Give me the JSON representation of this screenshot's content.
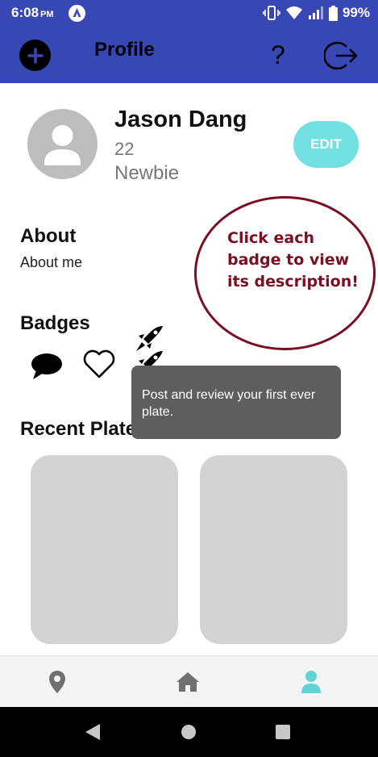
{
  "status_bar": {
    "time": "6:08",
    "ampm": "PM",
    "battery": "99%"
  },
  "app_bar": {
    "title": "Profile",
    "help_label": "?"
  },
  "profile": {
    "name": "Jason Dang",
    "age": "22",
    "rank": "Newbie",
    "edit_label": "EDIT"
  },
  "about": {
    "heading": "About",
    "text": "About me"
  },
  "tip": {
    "text": "Click each badge to view its description!",
    "color": "#7a0f22"
  },
  "badges": {
    "heading": "Badges",
    "items": [
      {
        "icon": "chat-bubble-icon"
      },
      {
        "icon": "heart-icon"
      },
      {
        "icon": "rocket-icon"
      },
      {
        "icon": "rocket-icon"
      }
    ]
  },
  "tooltip": {
    "text": "Post and review your first ever plate."
  },
  "recent_plates": {
    "heading": "Recent Plates",
    "count_visible": 2
  },
  "bottom_nav": {
    "items": [
      {
        "icon": "map-pin-icon",
        "active": false
      },
      {
        "icon": "home-icon",
        "active": false
      },
      {
        "icon": "profile-icon",
        "active": true
      }
    ],
    "active_color": "#5fd3d6",
    "inactive_color": "#707070"
  },
  "colors": {
    "app_bar": "#3748b4",
    "edit_button": "#72e0e0",
    "plate_card": "#d3d3d3"
  }
}
